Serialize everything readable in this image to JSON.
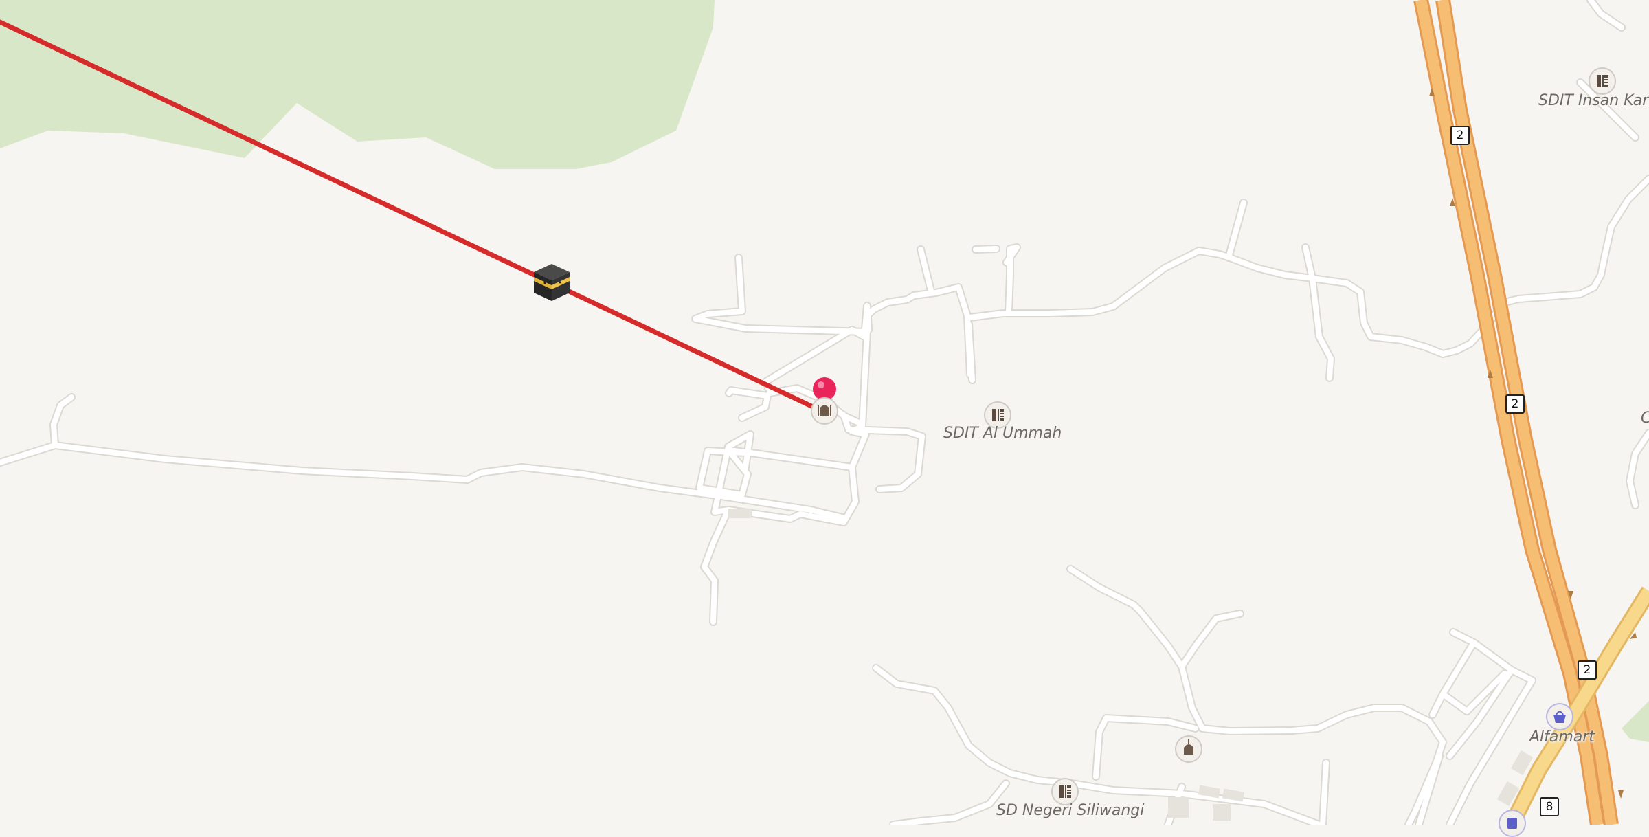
{
  "map": {
    "colors": {
      "land": "#f7f5f1",
      "forest": "#d9e7c9",
      "road": "#ffffff",
      "road_casing": "#dcd8d2",
      "highway": "#f6be73",
      "highway_casing": "#e49a52",
      "trunk": "#f8d98c",
      "qibla_line": "#d62b2b",
      "pin": "#e8245b"
    },
    "qibla_marker": {
      "icon": "kaaba-icon"
    },
    "location_pin": {
      "icon": "map-pin-icon"
    },
    "route_shields": [
      "2",
      "2",
      "2",
      "8"
    ],
    "places": [
      {
        "name": "SDIT Al Ummah",
        "icon": "school-icon"
      },
      {
        "name": "SDIT Insan Karim",
        "icon": "school-icon"
      },
      {
        "name": "SD Negeri Siliwangi",
        "icon": "school-icon"
      },
      {
        "name": "Alfamart",
        "icon": "shopping-basket-icon"
      },
      {
        "name": "",
        "icon": "mosque-icon"
      }
    ],
    "partial_label": "C"
  }
}
